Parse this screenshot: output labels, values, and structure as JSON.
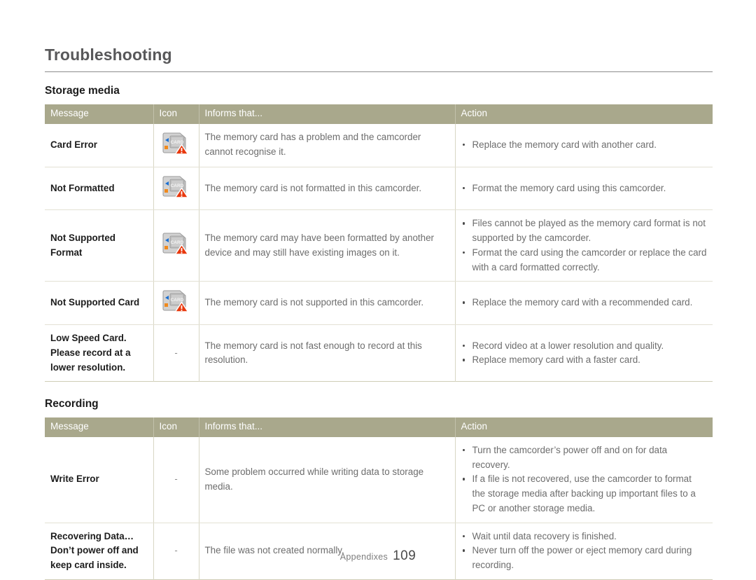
{
  "document": {
    "chapter_title": "Troubleshooting"
  },
  "sections": [
    {
      "heading": "Storage media",
      "columns": [
        "Message",
        "Icon",
        "Informs that...",
        "Action"
      ],
      "rows": [
        {
          "message": "Card Error",
          "icon": "memory-card-warning-icon",
          "informs": "The memory card has a problem and the camcorder cannot recognise it.",
          "actions": [
            "Replace the memory card with another card."
          ]
        },
        {
          "message": "Not Formatted",
          "icon": "memory-card-warning-icon",
          "informs": "The memory card is not formatted in this camcorder.",
          "actions": [
            "Format the memory card using this camcorder."
          ]
        },
        {
          "message": "Not Supported Format",
          "icon": "memory-card-warning-icon",
          "informs": "The memory card may have been formatted by another device and may still have existing images on it.",
          "actions": [
            "Files cannot be played as the memory card format is not supported by the camcorder.",
            "Format the card using the camcorder or replace the card with a card formatted correctly."
          ]
        },
        {
          "message": "Not Supported Card",
          "icon": "memory-card-warning-icon",
          "informs": "The memory card is not supported in this camcorder.",
          "actions": [
            "Replace the memory card with a recommended card."
          ]
        },
        {
          "message": "Low Speed Card. Please record at a lower resolution.",
          "icon": "dash",
          "icon_text": "-",
          "informs": "The memory card is not fast enough to record at this resolution.",
          "actions": [
            "Record video at a lower resolution and quality.",
            "Replace memory card with a faster card."
          ]
        }
      ]
    },
    {
      "heading": "Recording",
      "columns": [
        "Message",
        "Icon",
        "Informs that...",
        "Action"
      ],
      "rows": [
        {
          "message": "Write Error",
          "icon": "dash",
          "icon_text": "-",
          "informs": "Some problem occurred while writing data to storage media.",
          "actions": [
            "Turn the camcorder’s power off and on for data recovery.",
            "If a file is not recovered, use the camcorder to format the storage media after backing up important files to a PC or another storage media."
          ]
        },
        {
          "message": "Recovering Data… Don’t power off and keep card inside.",
          "icon": "dash",
          "icon_text": "-",
          "informs": "The file was not created normally.",
          "actions": [
            "Wait until data recovery is finished.",
            "Never turn off the power or eject memory card during recording."
          ]
        }
      ]
    }
  ],
  "footer": {
    "label": "Appendixes",
    "page_number": "109"
  },
  "colors": {
    "header_background": "#a9a88c",
    "header_text": "#ffffff",
    "body_text": "#6d6d6d",
    "message_text": "#1c1c1c",
    "title_text": "#58585a",
    "warning_triangle": "#e8380d",
    "card_body": "#cfcfcf",
    "card_accent_blue": "#1b6fd1",
    "card_accent_orange": "#f08a1e"
  }
}
